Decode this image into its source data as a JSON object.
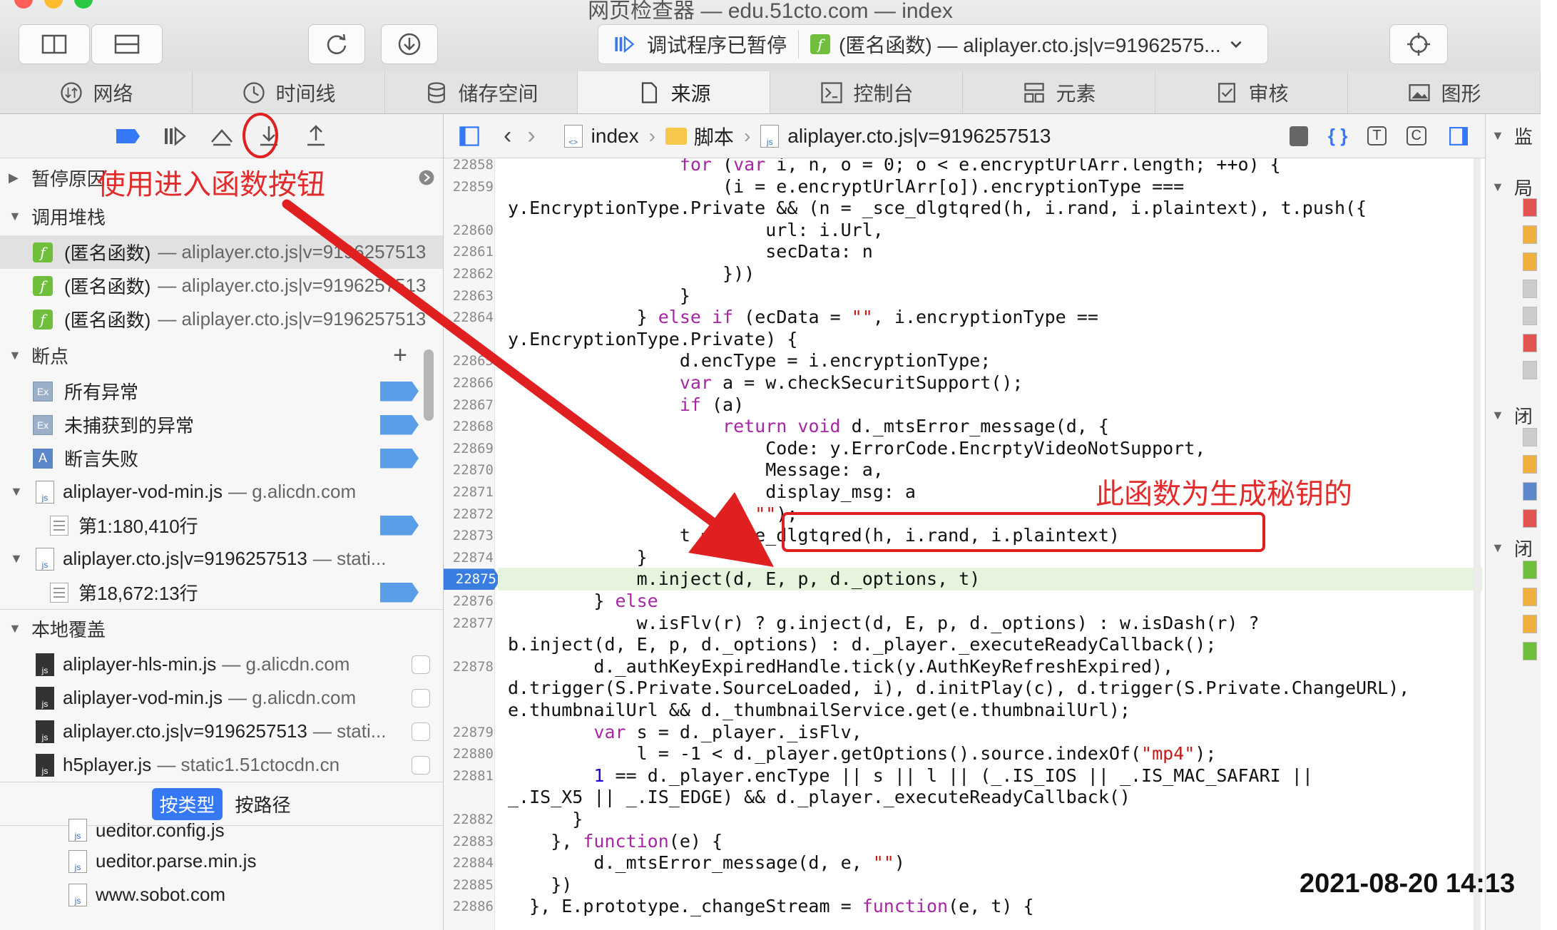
{
  "window": {
    "title": "网页检查器 — edu.51cto.com — index"
  },
  "toolbar": {
    "status_text": "调试程序已暂停",
    "frame_text": "(匿名函数) — aliplayer.cto.js|v=91962575..."
  },
  "tabs": [
    {
      "label": "网络"
    },
    {
      "label": "时间线"
    },
    {
      "label": "储存空间"
    },
    {
      "label": "来源"
    },
    {
      "label": "控制台"
    },
    {
      "label": "元素"
    },
    {
      "label": "审核"
    },
    {
      "label": "图形"
    }
  ],
  "sidebar": {
    "pause_reason_header": "暂停原因",
    "call_stack_header": "调用堆栈",
    "call_stack": [
      {
        "fn": "(匿名函数)",
        "loc": "— aliplayer.cto.js|v=9196257513"
      },
      {
        "fn": "(匿名函数)",
        "loc": "— aliplayer.cto.js|v=9196257513"
      },
      {
        "fn": "(匿名函数)",
        "loc": "— aliplayer.cto.js|v=9196257513"
      }
    ],
    "breakpoints_header": "断点",
    "breakpoints": [
      {
        "icon": "Ex",
        "label": "所有异常"
      },
      {
        "icon": "Ex",
        "label": "未捕获到的异常"
      },
      {
        "icon": "A",
        "label": "断言失败"
      }
    ],
    "bp_files": [
      {
        "name": "aliplayer-vod-min.js",
        "host": "— g.alicdn.com",
        "line": "第1:180,410行"
      },
      {
        "name": "aliplayer.cto.js|v=9196257513",
        "host": "— stati...",
        "line": "第18,672:13行"
      }
    ],
    "overrides_header": "本地覆盖",
    "overrides": [
      {
        "name": "aliplayer-hls-min.js",
        "host": "— g.alicdn.com"
      },
      {
        "name": "aliplayer-vod-min.js",
        "host": "— g.alicdn.com"
      },
      {
        "name": "aliplayer.cto.js|v=9196257513",
        "host": "— stati..."
      },
      {
        "name": "h5player.js",
        "host": "— static1.51ctocdn.cn"
      }
    ],
    "filter_by_type": "按类型",
    "filter_by_path": "按路径",
    "resources": [
      "ueditor.config.js",
      "ueditor.parse.min.js",
      "www.sobot.com"
    ]
  },
  "navbar": {
    "crumb_index": "index",
    "crumb_folder": "脚本",
    "crumb_file": "aliplayer.cto.js|v=9196257513"
  },
  "code": {
    "lines": [
      {
        "n": "22858",
        "t": "                for (var i, n, o = 0; o < e.encryptUrlArr.length; ++o) {"
      },
      {
        "n": "22859",
        "t": "                    (i = e.encryptUrlArr[o]).encryptionType ==="
      },
      {
        "n": "",
        "t": "y.EncryptionType.Private && (n = _sce_dlgtqred(h, i.rand, i.plaintext), t.push({"
      },
      {
        "n": "22860",
        "t": "                        url: i.Url,"
      },
      {
        "n": "22861",
        "t": "                        secData: n"
      },
      {
        "n": "22862",
        "t": "                    }))"
      },
      {
        "n": "22863",
        "t": "                }"
      },
      {
        "n": "22864",
        "t": "            } else if (ecData = \"\", i.encryptionType =="
      },
      {
        "n": "",
        "t": "y.EncryptionType.Private) {"
      },
      {
        "n": "22865",
        "t": "                d.encType = i.encryptionType;"
      },
      {
        "n": "22866",
        "t": "                var a = w.checkSecuritSupport();"
      },
      {
        "n": "22867",
        "t": "                if (a)"
      },
      {
        "n": "22868",
        "t": "                    return void d._mtsError_message(d, {"
      },
      {
        "n": "22869",
        "t": "                        Code: y.ErrorCode.EncrptyVideoNotSupport,"
      },
      {
        "n": "22870",
        "t": "                        Message: a,"
      },
      {
        "n": "22871",
        "t": "                        display_msg: a"
      },
      {
        "n": "22872",
        "t": "                    }, \"\");"
      },
      {
        "n": "22873",
        "t": "                t = _sce_dlgtqred(h, i.rand, i.plaintext)"
      },
      {
        "n": "22874",
        "t": "            }"
      },
      {
        "n": "22875",
        "t": "            m.inject(d, E, p, d._options, t)"
      },
      {
        "n": "22876",
        "t": "        } else"
      },
      {
        "n": "22877",
        "t": "            w.isFlv(r) ? g.inject(d, E, p, d._options) : w.isDash(r) ?"
      },
      {
        "n": "",
        "t": "b.inject(d, E, p, d._options) : d._player._executeReadyCallback();"
      },
      {
        "n": "22878",
        "t": "        d._authKeyExpiredHandle.tick(y.AuthKeyRefreshExpired),"
      },
      {
        "n": "",
        "t": "d.trigger(S.Private.SourceLoaded, i), d.initPlay(c), d.trigger(S.Private.ChangeURL),"
      },
      {
        "n": "",
        "t": "e.thumbnailUrl && d._thumbnailService.get(e.thumbnailUrl);"
      },
      {
        "n": "22879",
        "t": "        var s = d._player._isFlv,"
      },
      {
        "n": "22880",
        "t": "            l = -1 < d._player.getOptions().source.indexOf(\"mp4\");"
      },
      {
        "n": "22881",
        "t": "        1 == d._player.encType || s || l || (_.IS_IOS || _.IS_MAC_SAFARI ||"
      },
      {
        "n": "",
        "t": "_.IS_X5 || _.IS_EDGE) && d._player._executeReadyCallback()"
      },
      {
        "n": "22882",
        "t": "      }"
      },
      {
        "n": "22883",
        "t": "    }, function(e) {"
      },
      {
        "n": "22884",
        "t": "        d._mtsError_message(d, e, \"\")"
      },
      {
        "n": "22885",
        "t": "    })"
      },
      {
        "n": "22886",
        "t": "  }, E.prototype._changeStream = function(e, t) {"
      }
    ],
    "current_line": "22875"
  },
  "right_panel": {
    "h1": "监",
    "h2": "局",
    "h3": "闭",
    "h4": "闭"
  },
  "annotations": {
    "step_into_note": "使用进入函数按钮",
    "keygen_note": "此函数为生成秘钥的"
  },
  "timestamp": "2021-08-20 14:13",
  "colors": {
    "accent": "#3478f6",
    "annotation": "#e02020",
    "function_icon": "#6fbf3c"
  }
}
